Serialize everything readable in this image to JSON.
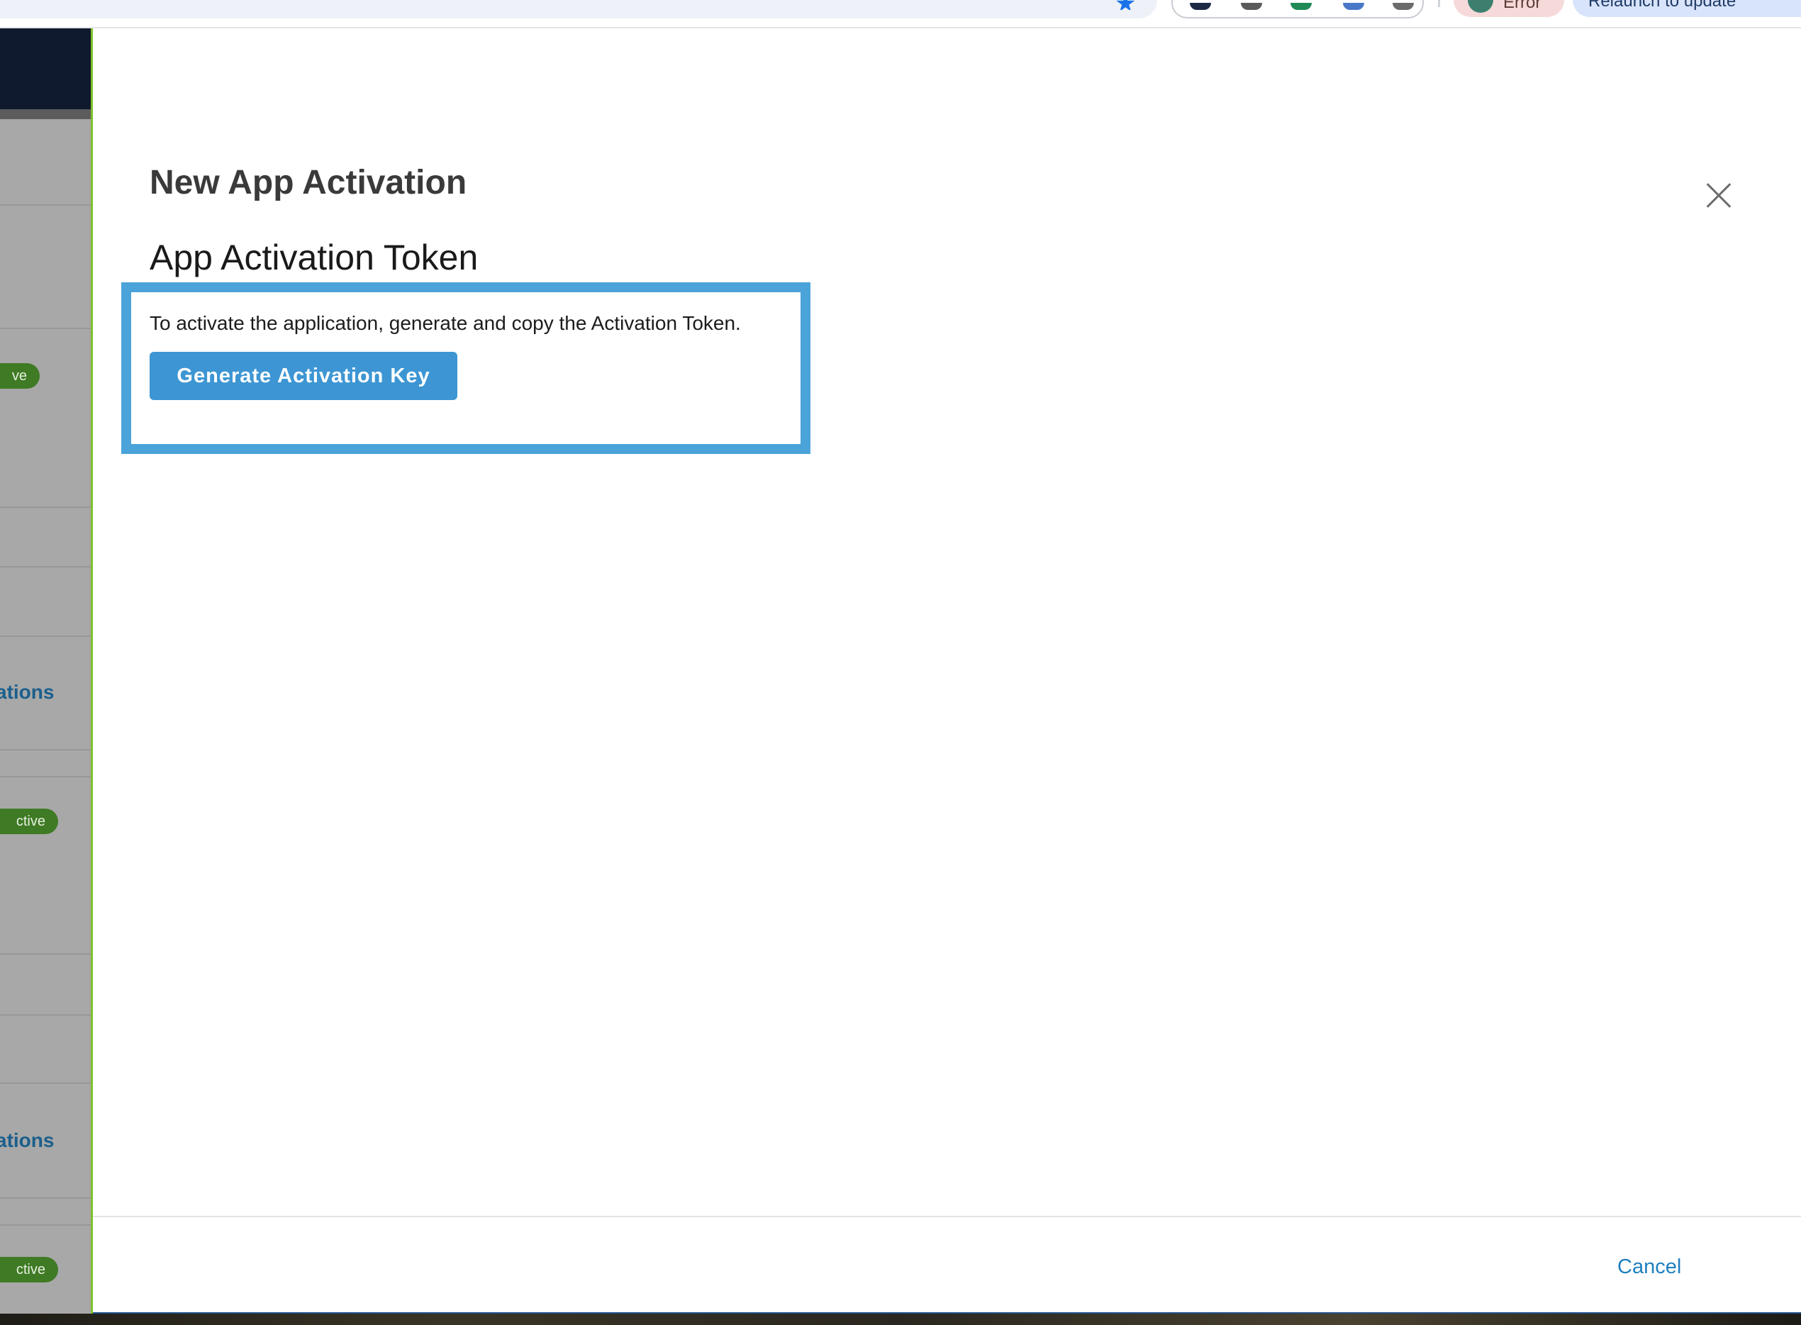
{
  "browser": {
    "error_label": "Error",
    "update_label": "Relaunch to update"
  },
  "background": {
    "badges": [
      "ve",
      "ctive",
      "ctive"
    ],
    "links": [
      "ations",
      "ations"
    ]
  },
  "modal": {
    "title": "New App Activation",
    "section_heading": "App Activation Token",
    "description": "To activate the application, generate and copy the Activation Token.",
    "generate_label": "Generate Activation Key",
    "cancel_label": "Cancel"
  },
  "colors": {
    "accent_blue": "#4aa3d9",
    "button_blue": "#3d96d3",
    "link_blue": "#1f7fbf",
    "status_green": "#3f7a25"
  }
}
